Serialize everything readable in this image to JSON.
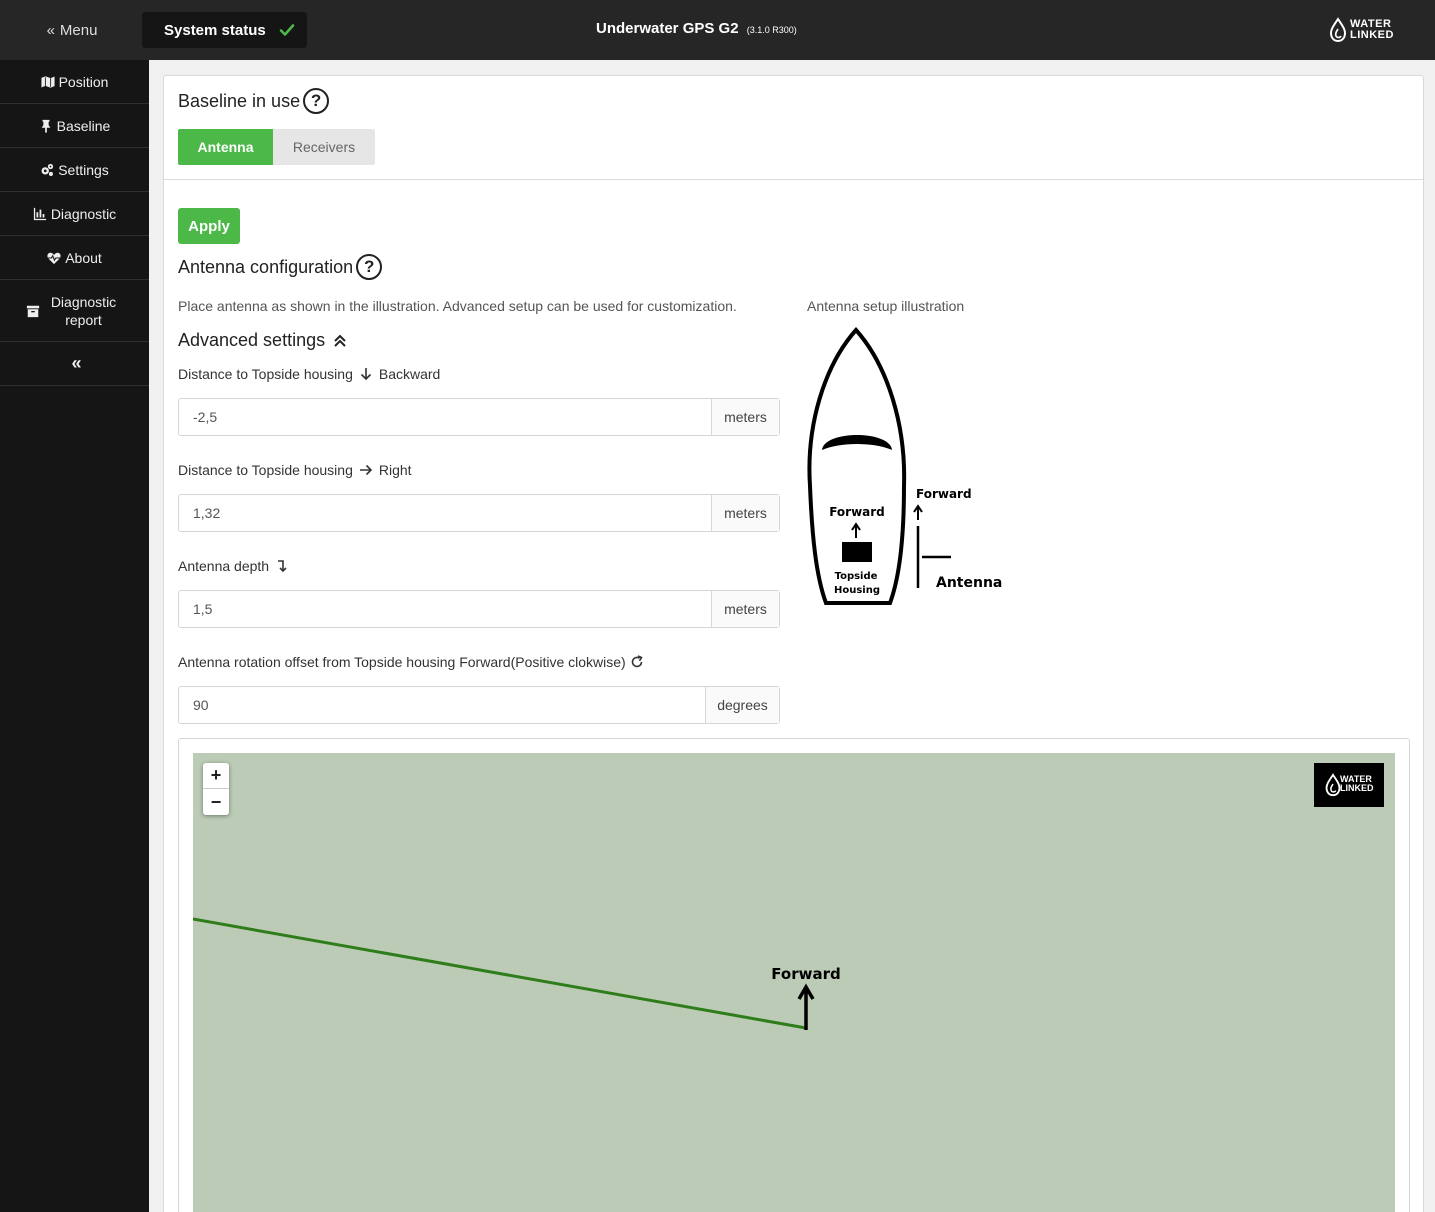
{
  "topbar": {
    "menu_label": "Menu",
    "status_label": "System status",
    "status_ok_color": "#4cb848",
    "title": "Underwater GPS G2",
    "version": "(3.1.0 R300)",
    "logo_line1": "WATER",
    "logo_line2": "LINKED"
  },
  "sidebar": {
    "items": [
      {
        "label": "Position",
        "icon": "map-icon"
      },
      {
        "label": "Baseline",
        "icon": "pin-icon"
      },
      {
        "label": "Settings",
        "icon": "gears-icon"
      },
      {
        "label": "Diagnostic",
        "icon": "chart-icon"
      },
      {
        "label": "About",
        "icon": "heartbeat-icon"
      },
      {
        "label": "Diagnostic report",
        "icon": "archive-icon"
      }
    ],
    "collapse_icon": "double-chevron-left-icon"
  },
  "baseline": {
    "title": "Baseline in use",
    "options": [
      "Antenna",
      "Receivers"
    ],
    "selected": "Antenna",
    "accent_color": "#4cb848"
  },
  "antenna": {
    "apply_label": "Apply",
    "title": "Antenna configuration",
    "description": "Place antenna as shown in the illustration. Advanced setup can be used for customization.",
    "illustration_caption": "Antenna setup illustration",
    "advanced_title": "Advanced settings",
    "fields": [
      {
        "label": "Distance to Topside housing",
        "direction": "Backward",
        "value": "-2,5",
        "unit": "meters",
        "icon": "arrow-down-icon"
      },
      {
        "label": "Distance to Topside housing",
        "direction": "Right",
        "value": "1,32",
        "unit": "meters",
        "icon": "arrow-right-icon"
      },
      {
        "label": "Antenna depth",
        "direction": "",
        "value": "1,5",
        "unit": "meters",
        "icon": "level-down-icon"
      },
      {
        "label": "Antenna rotation offset from Topside housing Forward(Positive clokwise)",
        "direction": "",
        "value": "90",
        "unit": "degrees",
        "icon": "rotate-icon"
      }
    ],
    "illustration": {
      "boat_forward": "Forward",
      "housing_line1": "Topside",
      "housing_line2": "Housing",
      "antenna_forward": "Forward",
      "antenna_label": "Antenna"
    }
  },
  "map": {
    "zoom_in": "+",
    "zoom_out": "−",
    "forward_label": "Forward",
    "logo_line1": "WATER",
    "logo_line2": "LINKED",
    "background_color": "#bbcbb5",
    "track_color": "#2e7d1a"
  }
}
